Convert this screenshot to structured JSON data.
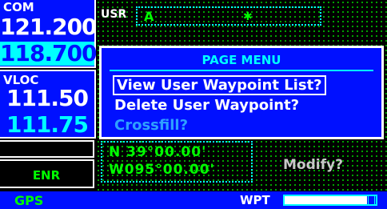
{
  "com": {
    "label": "COM",
    "active": "121.200",
    "standby": "118.700"
  },
  "vloc": {
    "label": "VLOC",
    "active": "111.50",
    "standby": "111.75"
  },
  "mode": {
    "enr": "ENR"
  },
  "status": {
    "gps": "GPS",
    "page_group": "WPT",
    "progress_fraction": 0.9
  },
  "waypoint": {
    "type_label": "USR",
    "ident": "A",
    "ident_cursor": "✱",
    "lat": "N 39°00.00'",
    "lon": "W095°00.00'",
    "modify": "Modify?"
  },
  "menu": {
    "title": "PAGE MENU",
    "items": [
      {
        "label": "View User Waypoint List?",
        "state": "selected"
      },
      {
        "label": "Delete User Waypoint?",
        "state": "enabled"
      },
      {
        "label": "Crossfill?",
        "state": "disabled"
      }
    ]
  },
  "colors": {
    "panel_blue": "#0010ff",
    "cyan": "#00ffff",
    "green": "#00ff00",
    "white": "#ffffff"
  }
}
